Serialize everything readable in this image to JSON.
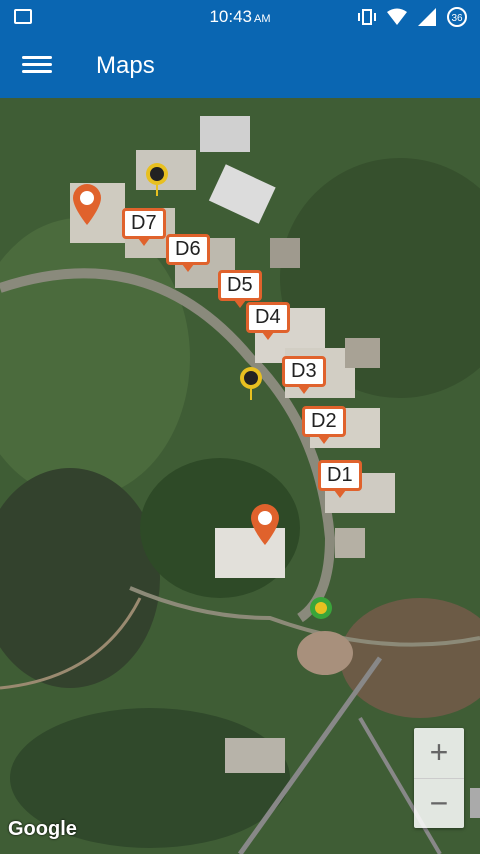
{
  "status": {
    "time": "10:43",
    "ampm": "AM",
    "badge": "36"
  },
  "appbar": {
    "title": "Maps"
  },
  "markers": [
    "D7",
    "D6",
    "D5",
    "D4",
    "D3",
    "D2",
    "D1"
  ],
  "zoom": {
    "in": "+",
    "out": "−"
  },
  "attribution": "Google"
}
